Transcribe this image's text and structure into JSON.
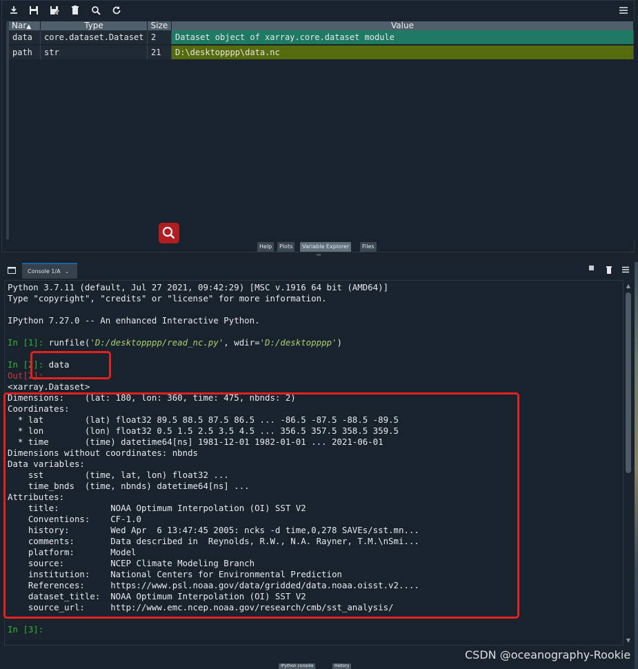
{
  "toolbar": {
    "icons": [
      "import-data-icon",
      "save-data-icon",
      "save-as-icon",
      "remove-all-icon",
      "search-icon",
      "refresh-icon",
      "options-menu-icon"
    ]
  },
  "variable_explorer": {
    "columns": [
      "Nar",
      "Type",
      "Size",
      "Value"
    ],
    "rows": [
      {
        "name": "data",
        "type": "core.dataset.Dataset",
        "size": "2",
        "value": "Dataset object of xarray.core.dataset module",
        "color": "#1f7a63"
      },
      {
        "name": "path",
        "type": "str",
        "size": "21",
        "value": "D:\\desktopppp\\data.nc",
        "color": "#556b0c"
      }
    ]
  },
  "pane_tabs": [
    "Help",
    "Plots",
    "Variable Explorer",
    "Files"
  ],
  "console": {
    "tab_label": "Console 1/A",
    "lines": {
      "l1": "Python 3.7.11 (default, Jul 27 2021, 09:42:29) [MSC v.1916 64 bit (AMD64)]",
      "l2": "Type \"copyright\", \"credits\" or \"license\" for more information.",
      "l3": "IPython 7.27.0 -- An enhanced Interactive Python.",
      "in1_prompt": "In [1]:",
      "in1_fn": " runfile(",
      "in1_arg1": "'D:/desktopppp/read_nc.py'",
      "in1_mid": ", wdir=",
      "in1_arg2": "'D:/desktopppp'",
      "in1_end": ")",
      "in2_prompt": "In [2]:",
      "in2_cmd": " data",
      "out2_prompt": "Out[2]:",
      "o1": "<xarray.Dataset>",
      "o2": "Dimensions:    (lat: 180, lon: 360, time: 475, nbnds: 2)",
      "o3": "Coordinates:",
      "o4": "  * lat        (lat) float32 89.5 88.5 87.5 86.5 ... -86.5 -87.5 -88.5 -89.5",
      "o5": "  * lon        (lon) float32 0.5 1.5 2.5 3.5 4.5 ... 356.5 357.5 358.5 359.5",
      "o6": "  * time       (time) datetime64[ns] 1981-12-01 1982-01-01 ... 2021-06-01",
      "o7": "Dimensions without coordinates: nbnds",
      "o8": "Data variables:",
      "o9": "    sst        (time, lat, lon) float32 ...",
      "o10": "    time_bnds  (time, nbnds) datetime64[ns] ...",
      "o11": "Attributes:",
      "o12": "    title:          NOAA Optimum Interpolation (OI) SST V2",
      "o13": "    Conventions:    CF-1.0",
      "o14": "    history:        Wed Apr  6 13:47:45 2005: ncks -d time,0,278 SAVEs/sst.mn...",
      "o15": "    comments:       Data described in  Reynolds, R.W., N.A. Rayner, T.M.\\nSmi...",
      "o16": "    platform:       Model",
      "o17": "    source:         NCEP Climate Modeling Branch",
      "o18": "    institution:    National Centers for Environmental Prediction",
      "o19": "    References:     https://www.psl.noaa.gov/data/gridded/data.noaa.oisst.v2....",
      "o20": "    dataset_title:  NOAA Optimum Interpolation (OI) SST V2",
      "o21": "    source_url:     http://www.emc.ncep.noaa.gov/research/cmb/sst_analysis/",
      "in3_prompt": "In [3]:"
    }
  },
  "bottom_tabs": [
    "IPython console",
    "History"
  ],
  "watermark": "CSDN @oceanography-Rookie"
}
